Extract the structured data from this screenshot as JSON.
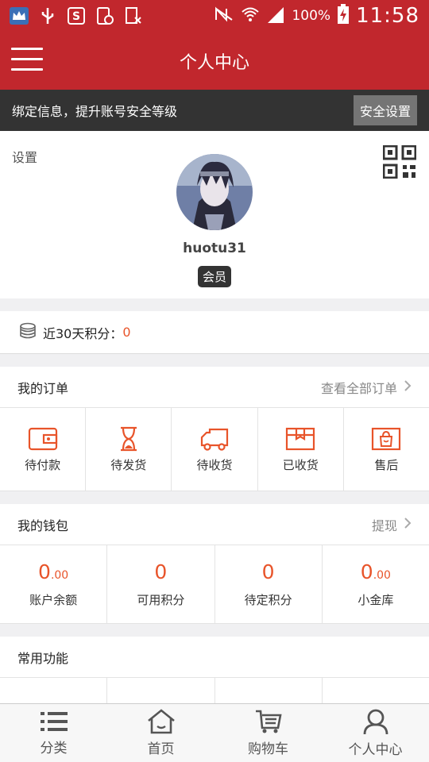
{
  "status_bar": {
    "battery": "100%",
    "time": "11:58"
  },
  "header": {
    "title": "个人中心"
  },
  "notice": {
    "text": "绑定信息，提升账号安全等级",
    "button": "安全设置"
  },
  "profile": {
    "settings": "设置",
    "username": "huotu31",
    "badge": "会员"
  },
  "points": {
    "label": "近30天积分：",
    "value": "0"
  },
  "orders": {
    "title": "我的订单",
    "more": "查看全部订单",
    "items": [
      {
        "label": "待付款",
        "icon": "wallet-icon"
      },
      {
        "label": "待发货",
        "icon": "hourglass-icon"
      },
      {
        "label": "待收货",
        "icon": "truck-icon"
      },
      {
        "label": "已收货",
        "icon": "box-icon"
      },
      {
        "label": "售后",
        "icon": "service-bag-icon"
      }
    ]
  },
  "wallet": {
    "title": "我的钱包",
    "more": "提现",
    "items": [
      {
        "int": "0",
        "dec": ".00",
        "label": "账户余额"
      },
      {
        "int": "0",
        "dec": "",
        "label": "可用积分"
      },
      {
        "int": "0",
        "dec": "",
        "label": "待定积分"
      },
      {
        "int": "0",
        "dec": ".00",
        "label": "小金库"
      }
    ]
  },
  "functions": {
    "title": "常用功能"
  },
  "tabs": [
    {
      "label": "分类",
      "icon": "list-icon"
    },
    {
      "label": "首页",
      "icon": "home-icon"
    },
    {
      "label": "购物车",
      "icon": "cart-icon"
    },
    {
      "label": "个人中心",
      "icon": "user-icon"
    }
  ],
  "colors": {
    "brand_red": "#c1272d",
    "accent_orange": "#e8542a",
    "dark_bar": "#333333"
  }
}
